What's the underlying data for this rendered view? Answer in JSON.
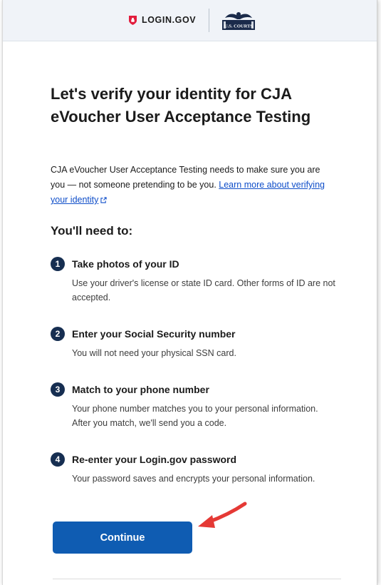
{
  "header": {
    "brand_text": "LOGIN.GOV",
    "partner_logo_text": "U.S. COURTS"
  },
  "main": {
    "title": "Let's verify your identity for CJA eVoucher User Acceptance Testing",
    "intro_text": "CJA eVoucher User Acceptance Testing needs to make sure you are you — not someone pretending to be you.",
    "learn_more_link": "Learn more about verifying your identity",
    "needs_heading": "You'll need to:",
    "steps": [
      {
        "number": "1",
        "title": "Take photos of your ID",
        "description": "Use your driver's license or state ID card. Other forms of ID are not accepted."
      },
      {
        "number": "2",
        "title": "Enter your Social Security number",
        "description": "You will not need your physical SSN card."
      },
      {
        "number": "3",
        "title": "Match to your phone number",
        "description": "Your phone number matches you to your personal information. After you match, we'll send you a code."
      },
      {
        "number": "4",
        "title": "Re-enter your Login.gov password",
        "description": "Your password saves and encrypts your personal information."
      }
    ],
    "continue_label": "Continue"
  },
  "colors": {
    "primary_button": "#0f5cb2",
    "step_badge": "#162e51",
    "link": "#0f4ec9",
    "arrow": "#e53935",
    "login_red": "#e21c3d"
  }
}
